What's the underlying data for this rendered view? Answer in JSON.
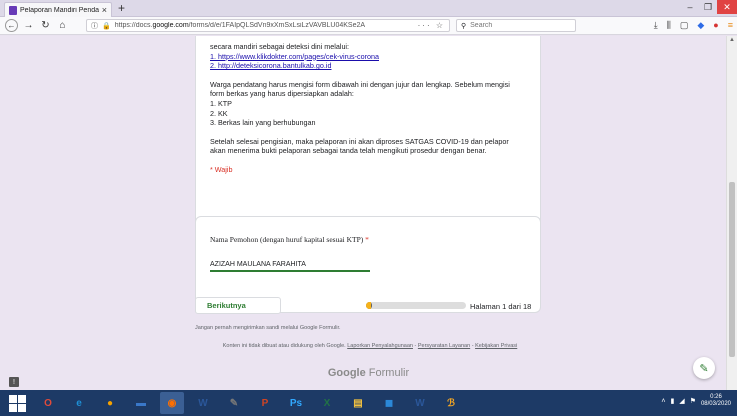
{
  "browser": {
    "tab_title": "Pelaporan Mandiri Pendatang",
    "tab_close": "×",
    "new_tab": "+",
    "url_prefix": "https://docs.",
    "url_domain": "google.com",
    "url_rest": "/forms/d/e/1FAIpQLSdVn9xXmSxLsiLzVAVBLU04KSe2A",
    "url_actions": "··· ☆",
    "search_placeholder": "Search"
  },
  "form": {
    "intro_line": "secara mandiri sebagai deteksi dini melalui:",
    "link1": "1. https://www.klikdokter.com/pages/cek-virus-corona",
    "link2": "2. http://deteksicorona.bantulkab.go.id",
    "instructions": "Warga pendatang harus mengisi form dibawah ini dengan jujur dan lengkap. Sebelum mengisi form berkas yang harus dipersiapkan adalah:",
    "doc1": "1. KTP",
    "doc2": "2. KK",
    "doc3": "3. Berkas lain yang berhubungan",
    "closing": "Setelah selesai pengisian, maka pelaporan ini akan diproses SATGAS COVID-19 dan pelapor akan menerima bukti pelaporan sebagai tanda telah mengikuti prosedur dengan benar.",
    "required_note": "* Wajib",
    "question_label": "Nama Pemohon (dengan huruf kapital sesuai KTP)",
    "question_star": "*",
    "answer_value": "AZIZAH MAULANA FARAHITA",
    "next_button": "Berikutnya",
    "progress": 0.055,
    "page_counter": "Halaman 1 dari 18",
    "password_warning": "Jangan pernah mengirimkan sandi melalui Google Formulir.",
    "legal_prefix": "Konten ini tidak dibuat atau didukung oleh Google.",
    "legal_link1": "Laporkan Penyalahgunaan",
    "legal_sep": "-",
    "legal_link2": "Persyaratan Layanan",
    "legal_link3": "Kebijakan Privasi",
    "brand_google": "Google",
    "brand_forms": "Formulir"
  },
  "taskbar": {
    "apps": [
      "O",
      "e",
      "●",
      "▬",
      "◉",
      "W",
      "✎",
      "P",
      "Ps",
      "X",
      "▤",
      "◼",
      "W",
      "ℬ"
    ],
    "time": "0:26",
    "date": "08/03/2020"
  },
  "colors": {
    "accent_green": "#2e7d32",
    "required_red": "#d93025",
    "forms_purple": "#673ab7",
    "taskbar": "#1d3a66"
  }
}
